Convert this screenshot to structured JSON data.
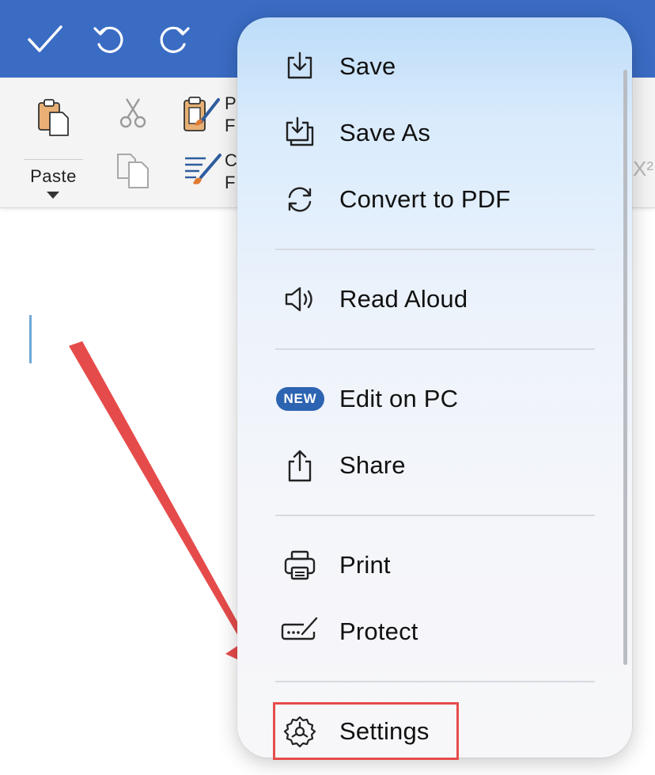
{
  "toolbar": {
    "confirm_icon": "checkmark-icon",
    "undo_icon": "undo-icon",
    "redo_icon": "redo-icon"
  },
  "ribbon": {
    "paste_label": "Paste",
    "format_painter_text_1": "P",
    "format_painter_text_2": "F",
    "clear_format_text_1": "C",
    "clear_format_text_2": "F",
    "superscript_partial": "X²"
  },
  "menu": {
    "items": [
      {
        "label": "Save",
        "icon": "save-icon"
      },
      {
        "label": "Save As",
        "icon": "save-as-icon"
      },
      {
        "label": "Convert to PDF",
        "icon": "convert-icon"
      },
      {
        "label": "Read Aloud",
        "icon": "speaker-icon"
      },
      {
        "label": "Edit on PC",
        "icon": "new-badge",
        "badge": "NEW"
      },
      {
        "label": "Share",
        "icon": "share-icon"
      },
      {
        "label": "Print",
        "icon": "printer-icon"
      },
      {
        "label": "Protect",
        "icon": "protect-icon"
      },
      {
        "label": "Settings",
        "icon": "gear-icon"
      }
    ]
  },
  "colors": {
    "app_bar": "#3a6cc4",
    "badge": "#2d64b2",
    "annotation": "#e64b4b"
  }
}
